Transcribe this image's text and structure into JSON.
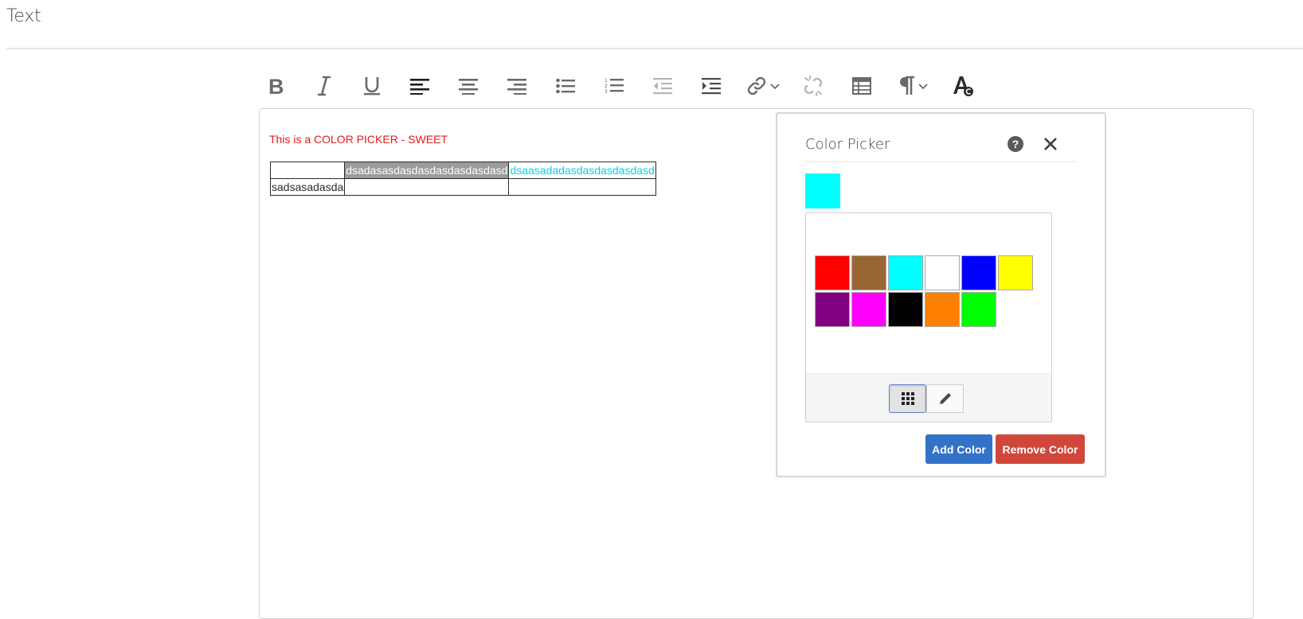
{
  "page": {
    "title": "Text"
  },
  "toolbar": {
    "items": [
      {
        "name": "bold-icon"
      },
      {
        "name": "italic-icon"
      },
      {
        "name": "underline-icon"
      },
      {
        "name": "align-left-icon"
      },
      {
        "name": "align-center-icon"
      },
      {
        "name": "align-right-icon"
      },
      {
        "name": "bullet-list-icon"
      },
      {
        "name": "numbered-list-icon"
      },
      {
        "name": "outdent-icon"
      },
      {
        "name": "indent-icon"
      },
      {
        "name": "link-icon"
      },
      {
        "name": "unlink-icon"
      },
      {
        "name": "table-icon"
      },
      {
        "name": "paragraph-icon"
      },
      {
        "name": "text-color-icon"
      }
    ]
  },
  "editor": {
    "colored_line": "This is a COLOR PICKER - SWEET",
    "colored_line_color": "#e11b1b",
    "table": {
      "rows": [
        [
          "",
          "dsadasasdasdasdasdasdasdasd",
          "dsaasadadasdasdasdasdasd"
        ],
        [
          "sadsasadasda",
          "",
          ""
        ]
      ]
    }
  },
  "color_picker": {
    "title": "Color Picker",
    "help_symbol": "?",
    "selected_color": "#00ffff",
    "swatches": [
      "#ff0000",
      "#996633",
      "#00ffff",
      "#ffffff",
      "#0000ff",
      "#ffff00",
      "#800080",
      "#ff00ff",
      "#000000",
      "#ff8000",
      "#00ff00"
    ],
    "add_button": "Add Color",
    "remove_button": "Remove Color",
    "add_button_color": "#3272c8",
    "remove_button_color": "#d1463b"
  }
}
